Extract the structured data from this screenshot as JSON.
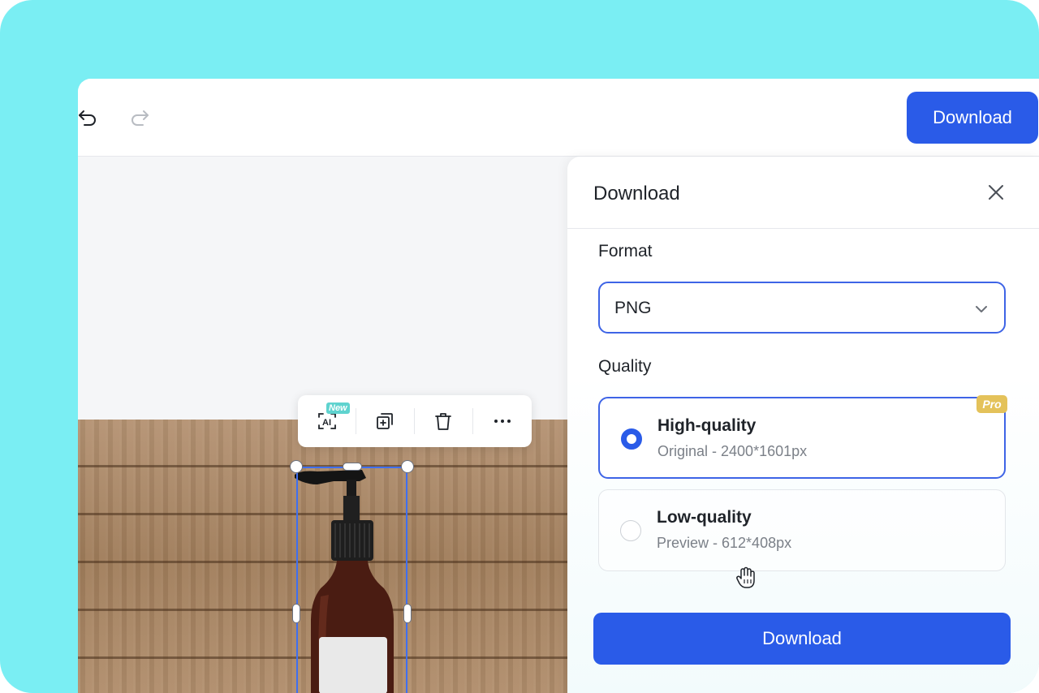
{
  "toolbar": {
    "undo_icon": "undo-icon",
    "redo_icon": "redo-icon",
    "download_label": "Download"
  },
  "floating_toolbar": {
    "ai_icon": "ai-scan-icon",
    "ai_icon_text": "AI",
    "new_badge": "New",
    "duplicate_icon": "duplicate-icon",
    "delete_icon": "trash-icon",
    "more_icon": "more-horizontal-icon"
  },
  "panel": {
    "title": "Download",
    "close_icon": "close-icon",
    "format": {
      "label": "Format",
      "selected": "PNG",
      "chevron_icon": "chevron-down-icon"
    },
    "quality": {
      "label": "Quality",
      "options": [
        {
          "title": "High-quality",
          "subtitle": "Original - 2400*1601px",
          "selected": true,
          "badge": "Pro"
        },
        {
          "title": "Low-quality",
          "subtitle": "Preview - 612*408px",
          "selected": false
        }
      ]
    },
    "download_label": "Download"
  },
  "colors": {
    "accent": "#2a5be8",
    "frame_bg": "#7aeef3",
    "pro_badge": "#e4c25a",
    "new_badge": "#5fd3cf"
  }
}
